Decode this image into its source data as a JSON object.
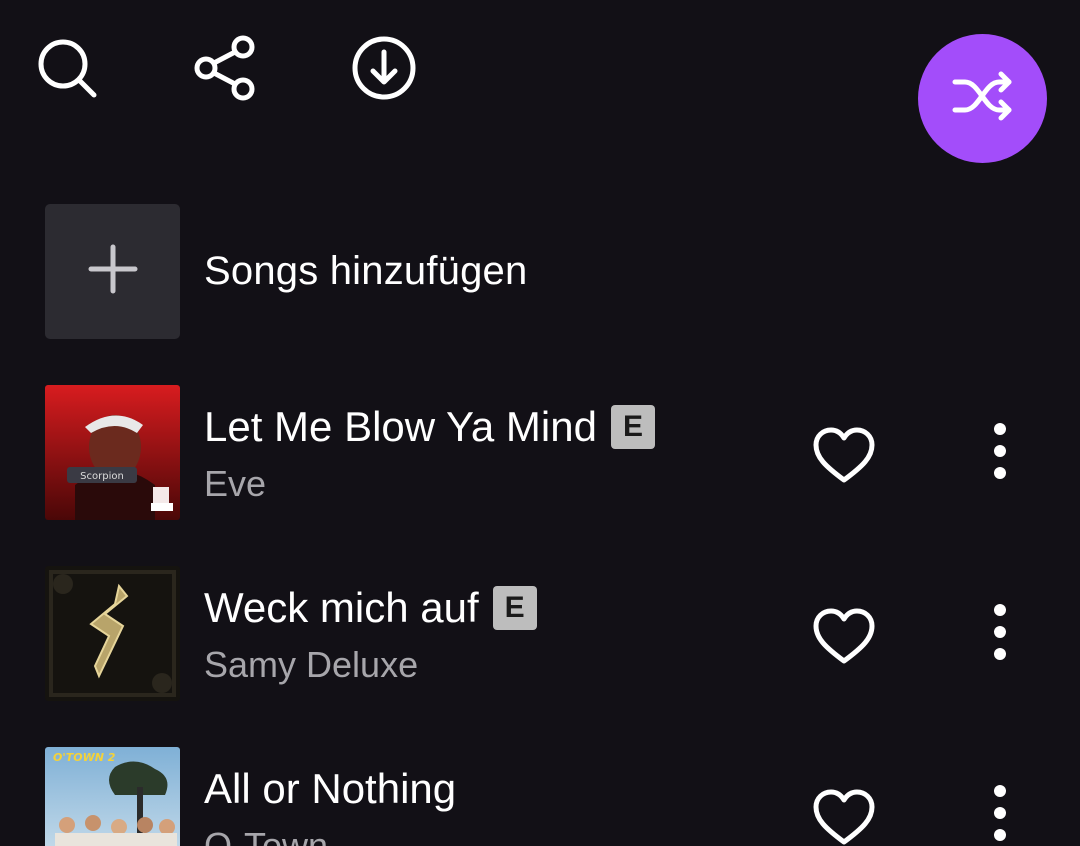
{
  "toolbar": {
    "icons": [
      "search-icon",
      "share-icon",
      "download-icon"
    ],
    "shuffle_icon": "shuffle-icon",
    "accent_color": "#a34dfa"
  },
  "add_songs": {
    "icon": "plus-icon",
    "label": "Songs hinzufügen"
  },
  "tracks": [
    {
      "title": "Let Me Blow Ya Mind",
      "explicit": "E",
      "artist": "Eve",
      "liked": false
    },
    {
      "title": "Weck mich auf",
      "explicit": "E",
      "artist": "Samy Deluxe",
      "liked": false
    },
    {
      "title": "All or Nothing",
      "artist": "O-Town",
      "liked": false
    }
  ],
  "covers": [
    {
      "colors": [
        "#c4171c",
        "#2a0404"
      ],
      "tag": ""
    },
    {
      "colors": [
        "#1b1813",
        "#0a0907"
      ],
      "tag": ""
    },
    {
      "colors": [
        "#7fb0d6",
        "#c9ddea"
      ],
      "tag": "O'TOWN 2"
    }
  ],
  "colors": {
    "background": "#121016",
    "tile": "#2c2b31",
    "secondary_text": "#a7a6ab",
    "badge": "#bdbdbd"
  }
}
